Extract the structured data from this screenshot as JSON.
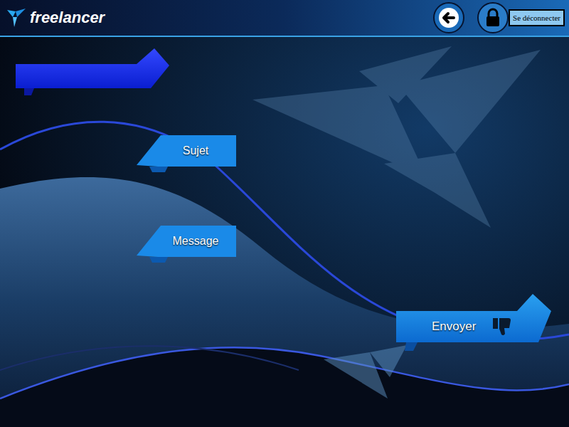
{
  "header": {
    "logo": "freelancer",
    "logout": "Se déconnecter"
  },
  "form": {
    "fields": [
      {
        "label": "Sujet"
      },
      {
        "label": "Message"
      }
    ],
    "submit": "Envoyer"
  }
}
